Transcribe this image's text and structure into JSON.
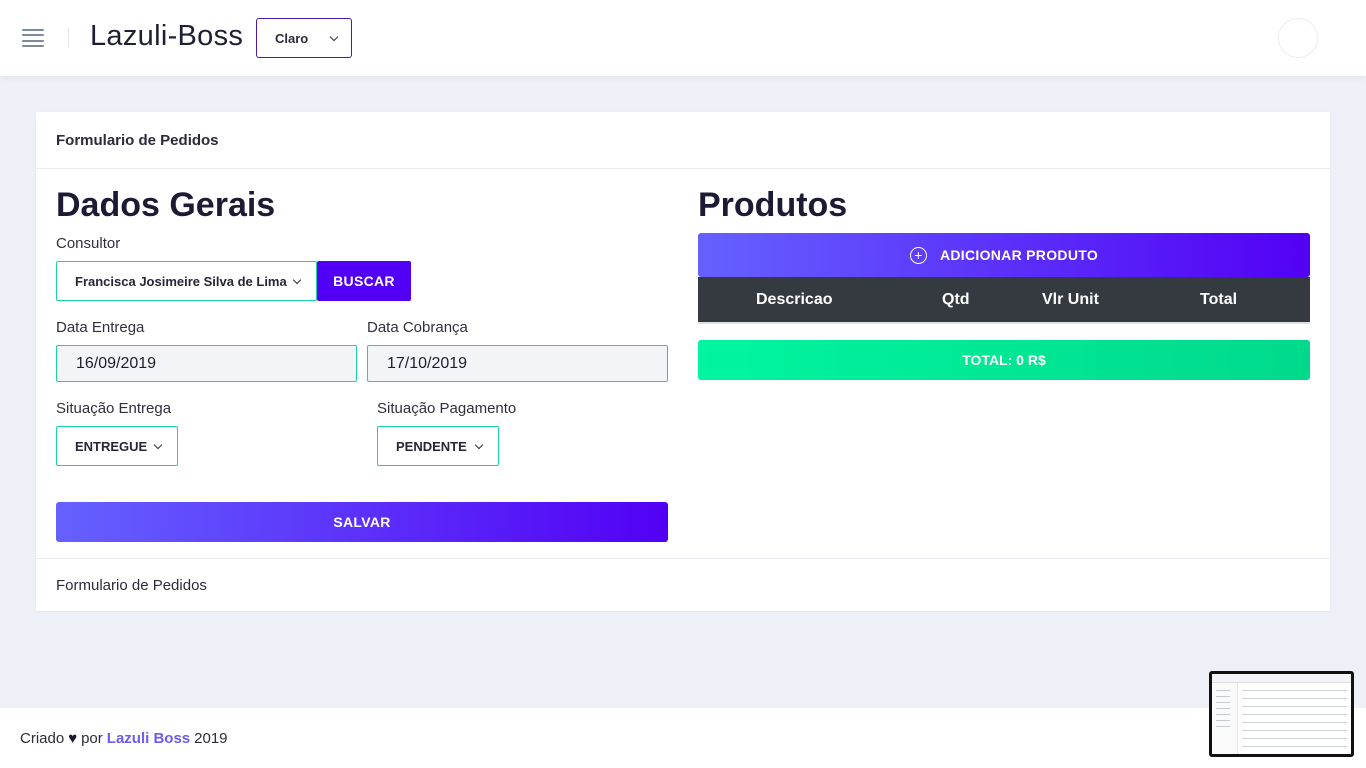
{
  "header": {
    "title": "Lazuli-Boss",
    "theme_select": {
      "value": "Claro"
    },
    "icons": {
      "menu": "hamburger-icon",
      "dropdown": "chevron-down-icon",
      "avatar": "avatar"
    }
  },
  "card": {
    "header_title": "Formulario de Pedidos",
    "footer_text": "Formulario de Pedidos"
  },
  "dados_gerais": {
    "title": "Dados Gerais",
    "consultor_label": "Consultor",
    "consultor_value": "Francisca Josimeire Silva de Lima",
    "buscar_label": "BUSCAR",
    "data_entrega_label": "Data Entrega",
    "data_entrega_value": "16/09/2019",
    "data_cobranca_label": "Data Cobrança",
    "data_cobranca_value": "17/10/2019",
    "situacao_entrega_label": "Situação Entrega",
    "situacao_entrega_value": "ENTREGUE",
    "situacao_pagamento_label": "Situação Pagamento",
    "situacao_pagamento_value": "PENDENTE",
    "salvar_label": "SALVAR"
  },
  "produtos": {
    "title": "Produtos",
    "add_label": "ADICIONAR PRODUTO",
    "columns": [
      "Descricao",
      "Qtd",
      "Vlr Unit",
      "Total"
    ],
    "total_label": "TOTAL: 0 R$"
  },
  "footer": {
    "prefix": "Criado",
    "heart": "♥",
    "by": "por",
    "brand": "Lazuli Boss",
    "year": "2019"
  },
  "colors": {
    "primary": "#5200f5",
    "gradient_start": "#6561ff",
    "accent_green": "#19d4a0",
    "total_green": "#00f5a0",
    "table_head": "#343a40",
    "brand_link": "#6b5cf0"
  }
}
